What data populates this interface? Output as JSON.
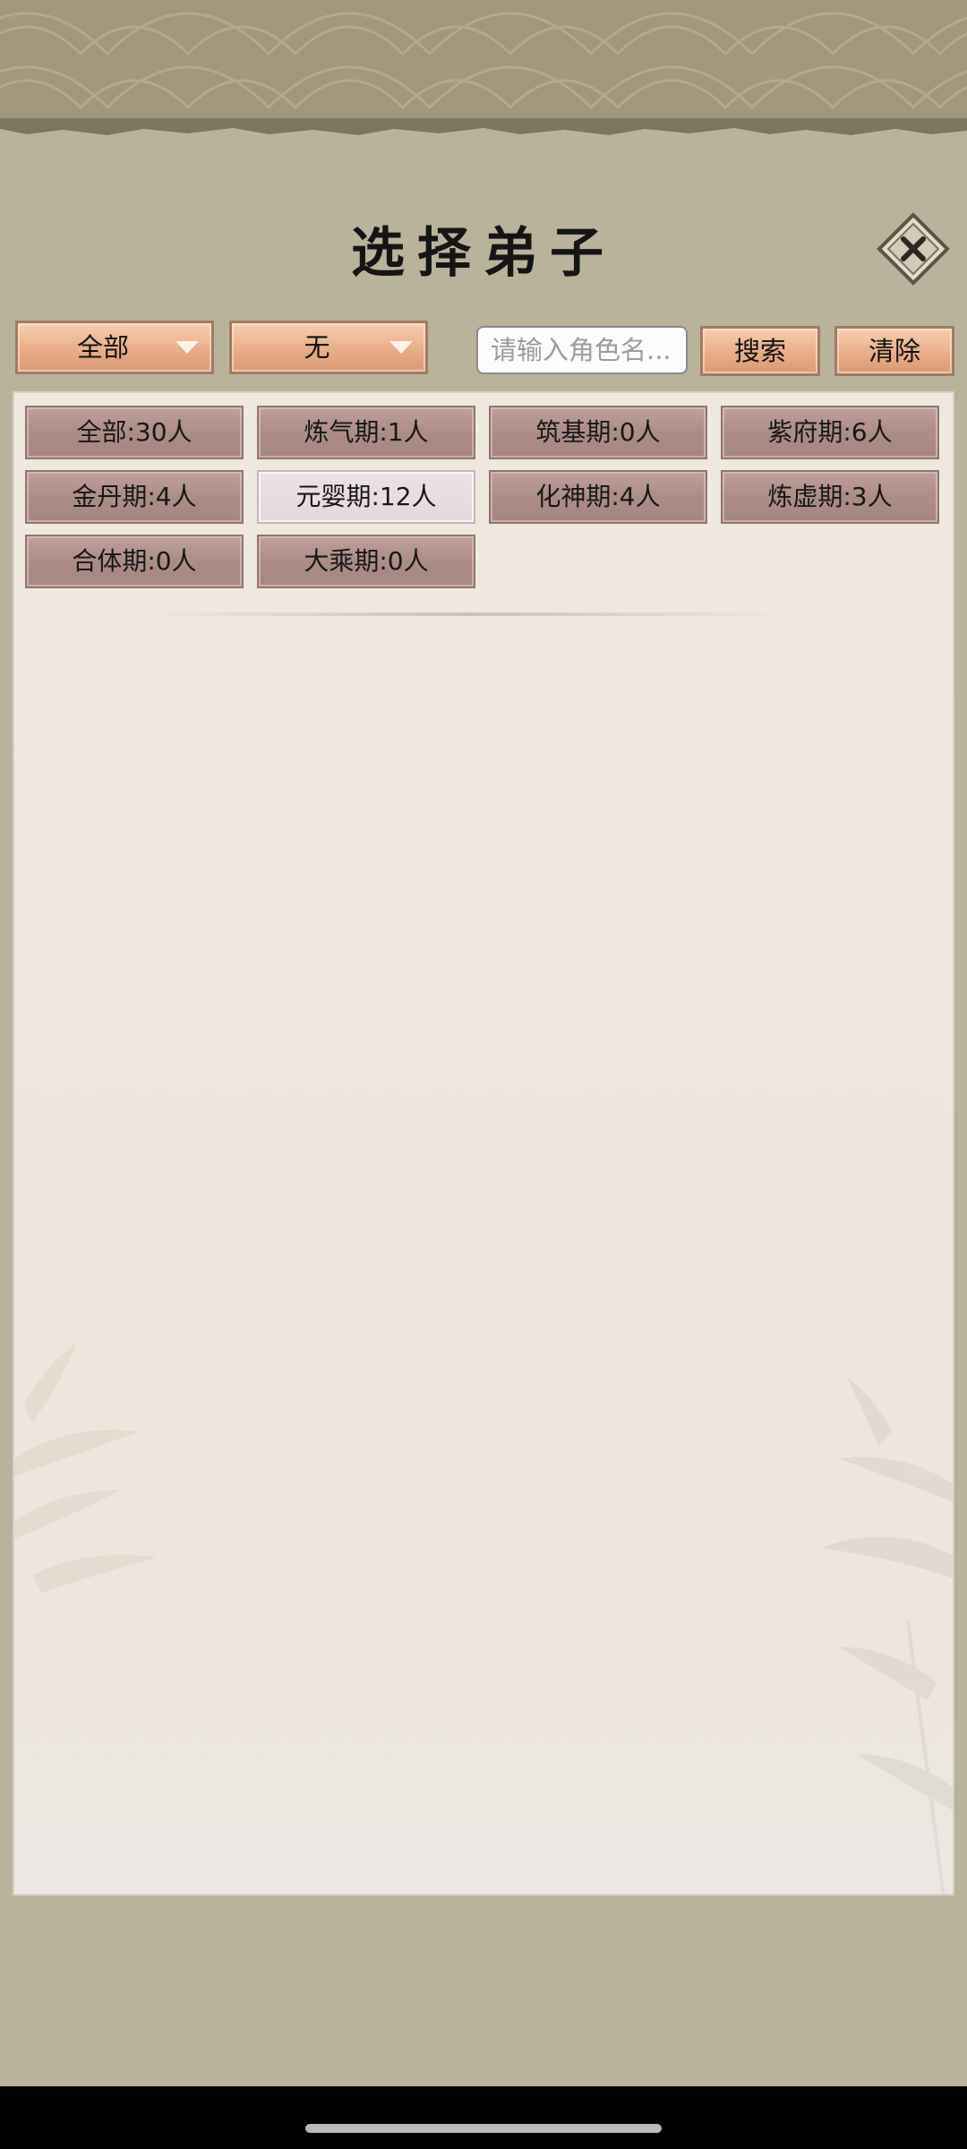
{
  "title": "选择弟子",
  "filters": {
    "realm_dropdown": "全部",
    "extra_dropdown": "无",
    "search_placeholder": "请输入角色名...",
    "search_value": "",
    "search_button": "搜索",
    "clear_button": "清除"
  },
  "realms": [
    {
      "label": "全部:30人",
      "selected": false
    },
    {
      "label": "炼气期:1人",
      "selected": false
    },
    {
      "label": "筑基期:0人",
      "selected": false
    },
    {
      "label": "紫府期:6人",
      "selected": false
    },
    {
      "label": "金丹期:4人",
      "selected": false
    },
    {
      "label": "元婴期:12人",
      "selected": true
    },
    {
      "label": "化神期:4人",
      "selected": false
    },
    {
      "label": "炼虚期:3人",
      "selected": false
    },
    {
      "label": "合体期:0人",
      "selected": false
    },
    {
      "label": "大乘期:0人",
      "selected": false
    }
  ],
  "colors": {
    "background": "#bab39b",
    "panel": "#efe8df",
    "button_orange": "#e9ad89",
    "chip_brown": "#ac8c87",
    "chip_selected": "#e5d8dc"
  },
  "icons": [
    "close-icon",
    "dropdown-arrow-icon",
    "wave-pattern",
    "bamboo-decoration"
  ]
}
